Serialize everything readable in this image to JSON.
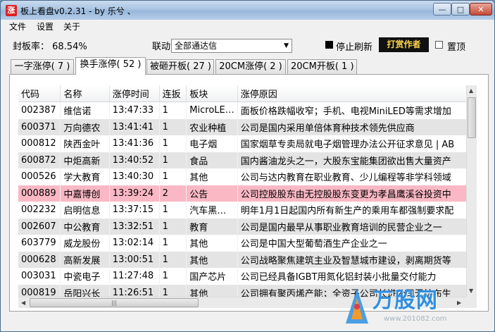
{
  "window": {
    "icon_text": "涨",
    "title": "板上看盘v0.2.31 - by 乐兮 、"
  },
  "menu": [
    "文件",
    "设置",
    "关于"
  ],
  "controls": {
    "seal_rate": "封板率： 68.54%",
    "link_label": "联动：",
    "link_value": "全部通达信",
    "stop_refresh": "停止刷新",
    "reward_button": "打赏作者",
    "pin_top": "置顶",
    "stop_refresh_checked": true,
    "pin_top_checked": false
  },
  "tabs": [
    {
      "label": "一字涨停( 7 )",
      "active": false
    },
    {
      "label": "换手涨停( 52 )",
      "active": true
    },
    {
      "label": "被砸开板( 27 )",
      "active": false
    },
    {
      "label": "20CM涨停( 2 )",
      "active": false
    },
    {
      "label": "20CM开板( 1 )",
      "active": false
    }
  ],
  "table": {
    "columns": [
      "代码",
      "名称",
      "涨停时间",
      "连扳",
      "板块",
      "涨停原因"
    ],
    "rows": [
      [
        "002387",
        "维信诺",
        "13:47:33",
        "1",
        "MicroLE…",
        "面板价格跌幅收窄；手机、电视MiniLED等需求增加"
      ],
      [
        "600371",
        "万向德农",
        "13:41:41",
        "1",
        "农业种植",
        "公司是国内采用单倍体育种技术领先供应商"
      ],
      [
        "000812",
        "陕西金叶",
        "13:41:36",
        "1",
        "电子烟",
        "国家烟草专卖局就电子烟管理办法公开征求意见 | AB"
      ],
      [
        "600872",
        "中炬高新",
        "13:40:52",
        "1",
        "食品",
        "国内酱油龙头之一，大股东宝能集团欲出售大量资产"
      ],
      [
        "000526",
        "学大教育",
        "13:40:30",
        "1",
        "其他",
        "公司与达内教育在职业教育、少儿编程等非学科领域"
      ],
      [
        "000889",
        "中嘉博创",
        "13:39:24",
        "2",
        "公告",
        "公司控股股东由无控股股东变更为孝昌鹰溪谷投资中"
      ],
      [
        "002232",
        "启明信息",
        "13:37:15",
        "1",
        "汽车黑…",
        "明年1月1日起国内所有新生产的乘用车都强制要求配"
      ],
      [
        "002607",
        "中公教育",
        "13:32:51",
        "1",
        "教育",
        "公司是国内最早从事职业教育培训的民营企业之一"
      ],
      [
        "603779",
        "威龙股份",
        "13:02:14",
        "1",
        "其他",
        "公司是中国大型葡萄酒生产企业之一"
      ],
      [
        "000628",
        "高新发展",
        "13:00:51",
        "1",
        "其他",
        "公司战略聚焦建筑主业及智慧城市建设，剥离期货等"
      ],
      [
        "003031",
        "中瓷电子",
        "11:27:48",
        "1",
        "国产芯片",
        "公司已经具备IGBT用氮化铝封装小批量交付能力"
      ],
      [
        "000819",
        "岳阳兴长",
        "11:26:51",
        "1",
        "其他",
        "公司拥有聚丙烯产能；全资子公司长进公司无纺布生"
      ]
    ],
    "highlight_row": 5
  },
  "watermark": {
    "brand": "万股网",
    "url": "www.201082.com"
  }
}
